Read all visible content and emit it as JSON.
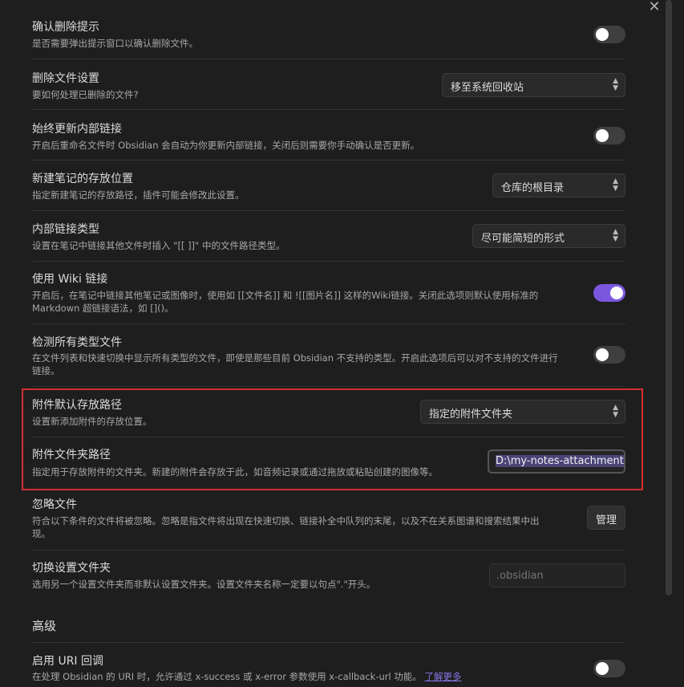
{
  "close_glyph": "✕",
  "settings": {
    "confirm_delete": {
      "name": "确认删除提示",
      "desc": "是否需要弹出提示窗口以确认删除文件。",
      "toggle_on": false
    },
    "delete_files": {
      "name": "删除文件设置",
      "desc": "要如何处理已删除的文件?",
      "value": "移至系统回收站"
    },
    "auto_update_links": {
      "name": "始终更新内部链接",
      "desc": "开启后重命名文件时 Obsidian 会自动为你更新内部链接，关闭后则需要你手动确认是否更新。",
      "toggle_on": false
    },
    "new_note_location": {
      "name": "新建笔记的存放位置",
      "desc": "指定新建笔记的存放路径，插件可能会修改此设置。",
      "value": "仓库的根目录"
    },
    "link_format": {
      "name": "内部链接类型",
      "desc": "设置在笔记中链接其他文件时插入 \"[[ ]]\" 中的文件路径类型。",
      "value": "尽可能简短的形式"
    },
    "wiki_links": {
      "name": "使用 Wiki 链接",
      "desc_line1": "开启后，在笔记中链接其他笔记或图像时，使用如 [[文件名]] 和 ![[图片名]] 这样的Wiki链接。关闭此选项则默认使用标准的",
      "desc_line2": "Markdown 超链接语法，如 []()。",
      "toggle_on": true
    },
    "detect_all_files": {
      "name": "检测所有类型文件",
      "desc_line1": "在文件列表和快速切换中显示所有类型的文件，即使是那些目前 Obsidian 不支持的类型。开启此选项后可以对不支持的文件进行",
      "desc_line2": "链接。",
      "toggle_on": false
    },
    "attachment_location": {
      "name": "附件默认存放路径",
      "desc": "设置新添加附件的存放位置。",
      "value": "指定的附件文件夹"
    },
    "attachment_folder": {
      "name": "附件文件夹路径",
      "desc": "指定用于存放附件的文件夹。新建的附件会存放于此，如音频记录或通过拖放或粘贴创建的图像等。",
      "value": "D:\\my-notes-attachment"
    },
    "excluded_files": {
      "name": "忽略文件",
      "desc_line1": "符合以下条件的文件将被忽略。忽略是指文件将出现在快速切换、链接补全中队列的末尾，以及不在关系图谱和搜索结果中出",
      "desc_line2": "现。",
      "button": "管理"
    },
    "config_dir": {
      "name": "切换设置文件夹",
      "desc": "选用另一个设置文件夹而非默认设置文件夹。设置文件夹名称一定要以句点\".\"开头。",
      "placeholder": ".obsidian"
    }
  },
  "advanced_heading": "高级",
  "uri_callbacks": {
    "name": "启用 URI 回调",
    "desc": "在处理 Obsidian 的 URI 时，允许通过 x-success 或 x-error 参数使用 x-callback-url 功能。",
    "link": "了解更多",
    "toggle_on": false
  },
  "colors": {
    "accent": "#7b57e0",
    "highlight_border": "#d32f2f",
    "background": "#1e1e1e"
  }
}
